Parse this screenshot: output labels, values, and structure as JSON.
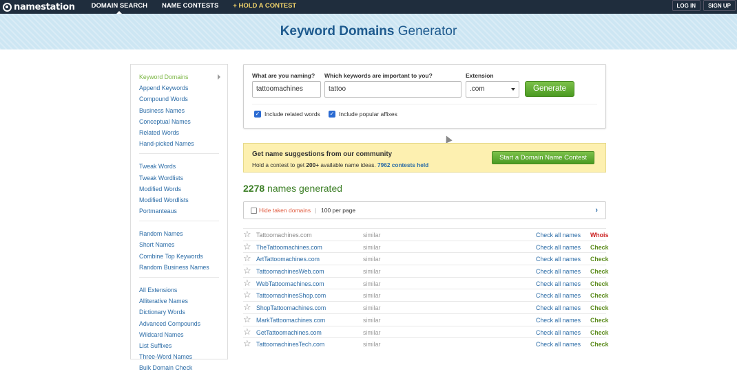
{
  "brand": {
    "name": "namestation"
  },
  "nav": {
    "items": [
      {
        "label": "DOMAIN SEARCH",
        "active": true
      },
      {
        "label": "NAME CONTESTS"
      },
      {
        "label": "+ HOLD A CONTEST"
      }
    ],
    "login": "LOG IN",
    "signup": "SIGN UP"
  },
  "hero": {
    "title_bold": "Keyword Domains",
    "title_rest": "Generator"
  },
  "sidebar": {
    "groups": [
      [
        "Keyword Domains",
        "Append Keywords",
        "Compound Words",
        "Business Names",
        "Conceptual Names",
        "Related Words",
        "Hand-picked Names"
      ],
      [
        "Tweak Words",
        "Tweak Wordlists",
        "Modified Words",
        "Modified Wordlists",
        "Portmanteaus"
      ],
      [
        "Random Names",
        "Short Names",
        "Combine Top Keywords",
        "Random Business Names"
      ],
      [
        "All Extensions",
        "Alliterative Names",
        "Dictionary Words",
        "Advanced Compounds",
        "Wildcard Names",
        "List Suffixes",
        "Three-Word Names",
        "Bulk Domain Check"
      ]
    ],
    "active": "Keyword Domains"
  },
  "form": {
    "naming_label": "What are you naming?",
    "naming_value": "tattoomachines",
    "keywords_label": "Which keywords are important to you?",
    "keywords_value": "tattoo",
    "extension_label": "Extension",
    "extension_value": ".com",
    "generate_label": "Generate",
    "related_label": "Include related words",
    "affixes_label": "Include popular affixes"
  },
  "promo": {
    "title": "Get name suggestions from our community",
    "text_pre": "Hold a contest to get ",
    "text_bold": "200+",
    "text_mid": " available name ideas. ",
    "text_link": "7962 contests held",
    "button": "Start a Domain Name Contest"
  },
  "summary": {
    "count": "2278",
    "suffix": " names generated"
  },
  "filter": {
    "hide_label": "Hide taken domains",
    "separator": "|",
    "per_page": "100 per page",
    "next": "›"
  },
  "results": {
    "rows": [
      {
        "domain": "Tattoomachines.com",
        "similar": "similar",
        "check_all": "Check all names",
        "status": "Whois",
        "taken": true
      },
      {
        "domain": "TheTattoomachines.com",
        "similar": "similar",
        "check_all": "Check all names",
        "status": "Check"
      },
      {
        "domain": "ArtTattoomachines.com",
        "similar": "similar",
        "check_all": "Check all names",
        "status": "Check"
      },
      {
        "domain": "TattoomachinesWeb.com",
        "similar": "similar",
        "check_all": "Check all names",
        "status": "Check"
      },
      {
        "domain": "WebTattoomachines.com",
        "similar": "similar",
        "check_all": "Check all names",
        "status": "Check"
      },
      {
        "domain": "TattoomachinesShop.com",
        "similar": "similar",
        "check_all": "Check all names",
        "status": "Check"
      },
      {
        "domain": "ShopTattoomachines.com",
        "similar": "similar",
        "check_all": "Check all names",
        "status": "Check"
      },
      {
        "domain": "MarkTattoomachines.com",
        "similar": "similar",
        "check_all": "Check all names",
        "status": "Check"
      },
      {
        "domain": "GetTattoomachines.com",
        "similar": "similar",
        "check_all": "Check all names",
        "status": "Check"
      },
      {
        "domain": "TattoomachinesTech.com",
        "similar": "similar",
        "check_all": "Check all names",
        "status": "Check"
      }
    ]
  },
  "colors": {
    "accent_green": "#5c8c1e",
    "link_blue": "#2a6ba6",
    "header_bg": "#1f2d3d",
    "whois_red": "#cc2222"
  }
}
